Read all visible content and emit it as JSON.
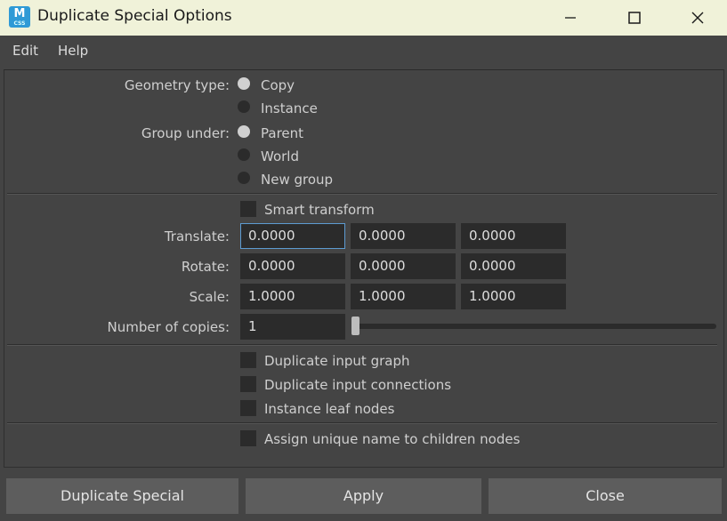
{
  "window": {
    "title": "Duplicate Special Options",
    "icon_letter": "M",
    "icon_sub": "CSS",
    "controls": [
      "minimize-icon",
      "maximize-icon",
      "close-icon"
    ]
  },
  "menu": {
    "edit": "Edit",
    "help": "Help"
  },
  "geometry_type": {
    "label": "Geometry type:",
    "options": [
      "Copy",
      "Instance"
    ],
    "selected": "Copy"
  },
  "group_under": {
    "label": "Group under:",
    "options": [
      "Parent",
      "World",
      "New group"
    ],
    "selected": "Parent"
  },
  "smart_transform": {
    "label": "Smart transform",
    "checked": false
  },
  "translate": {
    "label": "Translate:",
    "values": [
      "0.0000",
      "0.0000",
      "0.0000"
    ]
  },
  "rotate": {
    "label": "Rotate:",
    "values": [
      "0.0000",
      "0.0000",
      "0.0000"
    ]
  },
  "scale": {
    "label": "Scale:",
    "values": [
      "1.0000",
      "1.0000",
      "1.0000"
    ]
  },
  "copies": {
    "label": "Number of copies:",
    "value": "1",
    "slider_fraction": 0
  },
  "options": [
    "Duplicate input graph",
    "Duplicate input connections",
    "Instance leaf nodes"
  ],
  "assign_unique": "Assign unique name to children nodes",
  "buttons": {
    "duplicate": "Duplicate Special",
    "apply": "Apply",
    "close": "Close"
  },
  "colors": {
    "title_bar": "#f0f2d9",
    "panel": "#444444",
    "field": "#2b2b2b",
    "focus": "#5d9bd1",
    "button": "#5d5d5d"
  }
}
